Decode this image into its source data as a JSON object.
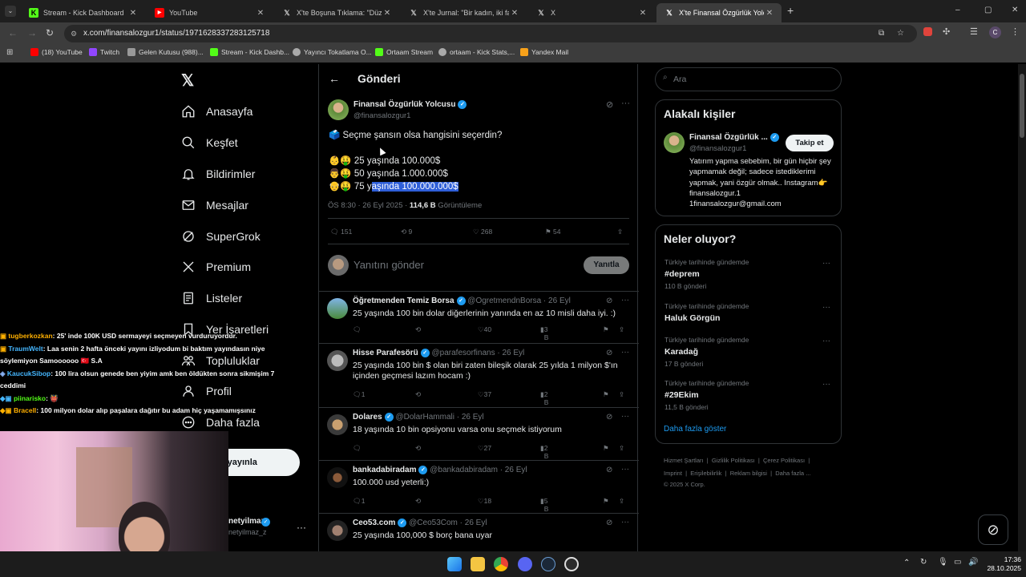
{
  "browser": {
    "tabs": [
      {
        "title": "Stream - Kick Dashboard",
        "icon": "kick-icon"
      },
      {
        "title": "YouTube",
        "icon": "youtube-icon"
      },
      {
        "title": "X'te Boşuna Tıklama: \"Düzce'de",
        "icon": "x-icon"
      },
      {
        "title": "X'te Jurnal: \"Bir kadın, iki farklı",
        "icon": "x-icon"
      },
      {
        "title": "X",
        "icon": "x-icon"
      },
      {
        "title": "X'te Finansal Özgürlük Yolcusu:",
        "icon": "x-icon"
      }
    ],
    "new_tab": "+",
    "url": "x.com/finansalozgur1/status/1971628337283125718",
    "bookmarks": [
      "(18) YouTube",
      "Twitch",
      "Gelen Kutusu (988)...",
      "Stream - Kick Dashb...",
      "Yayıncı Tokatlama O...",
      "Ortaam Stream",
      "ortaam - Kick Stats,...",
      "Yandex Mail"
    ],
    "window_controls": [
      "–",
      "▢",
      "✕"
    ]
  },
  "sidebar": {
    "items": [
      {
        "label": "Anasayfa",
        "icon": "home-icon"
      },
      {
        "label": "Keşfet",
        "icon": "search-icon"
      },
      {
        "label": "Bildirimler",
        "icon": "bell-icon"
      },
      {
        "label": "Mesajlar",
        "icon": "mail-icon"
      },
      {
        "label": "SuperGrok",
        "icon": "grok-icon"
      },
      {
        "label": "Premium",
        "icon": "x-icon"
      },
      {
        "label": "Listeler",
        "icon": "list-icon"
      },
      {
        "label": "Yer İşaretleri",
        "icon": "bookmark-icon"
      },
      {
        "label": "Topluluklar",
        "icon": "people-icon"
      },
      {
        "label": "Profil",
        "icon": "person-icon"
      },
      {
        "label": "Daha fazla",
        "icon": "more-icon"
      }
    ],
    "post_button": "eri yayınla",
    "account_name": "netyilmaz",
    "account_handle": "netyilmaz_z",
    "more": "···"
  },
  "header": {
    "title": "Gönderi",
    "back": "←"
  },
  "tweet": {
    "author": "Finansal Özgürlük Yolcusu",
    "handle": "@finansalozgur1",
    "line1": "Seçme şansın olsa hangisini seçerdin?",
    "line2": "25 yaşında 100.000$",
    "line3": "50 yaşında 1.000.000$",
    "line4_pre": "75 y",
    "line4_sel": "aşında 100.000.000$",
    "time": "ÖS 8:30 · 26 Eyl 2025 · ",
    "views_num": "114,6 B",
    "views_label": " Görüntüleme",
    "stats": {
      "replies": "151",
      "reposts": "9",
      "likes": "268",
      "bookmarks": "54"
    }
  },
  "compose": {
    "placeholder": "Yanıtını gönder",
    "button": "Yanıtla"
  },
  "replies": [
    {
      "name": "Öğretmenden Temiz Borsa",
      "handle": "@OgretmendnBorsa · 26 Eyl",
      "text": "25 yaşında 100 bin dolar diğerlerinin yanında en az 10 misli daha iyi. :)",
      "r": "",
      "rt": "",
      "l": "40",
      "v": "3 B"
    },
    {
      "name": "Hisse Parafesörü",
      "handle": "@parafesorfinans · 26 Eyl",
      "text": "25 yaşında 100 bin $ olan biri zaten bileşik olarak 25 yılda 1 milyon $'ın içinden geçmesi lazım hocam :)",
      "r": "1",
      "rt": "",
      "l": "37",
      "v": "2 B"
    },
    {
      "name": "Dolares",
      "handle": "@DolarHammali · 26 Eyl",
      "text": "18 yaşında 10 bin opsiyonu varsa onu seçmek istiyorum",
      "r": "",
      "rt": "",
      "l": "27",
      "v": "2 B"
    },
    {
      "name": "bankadabiradam",
      "handle": "@bankadabiradam · 26 Eyl",
      "text": "100.000 usd yeterli:)",
      "r": "1",
      "rt": "",
      "l": "18",
      "v": "5 B"
    },
    {
      "name": "Ceo53.com",
      "handle": "@Ceo53Com · 26 Eyl",
      "text": "25 yaşında 100,000 $ borç bana uyar",
      "r": "",
      "rt": "",
      "l": "",
      "v": ""
    }
  ],
  "right": {
    "search_placeholder": "Ara",
    "related_title": "Alakalı kişiler",
    "related_name": "Finansal Özgürlük ...",
    "related_handle": "@finansalozgur1",
    "follow_button": "Takip et",
    "related_bio": "Yatırım yapma sebebim, bir gün hiçbir şey yapmamak değil; sadece istediklerimi yapmak, yani özgür olmak.. Instagram👉 finansalozgur.1 1finansalozgur@gmail.com",
    "trends_title": "Neler oluyor?",
    "trends": [
      {
        "cat": "Türkiye tarihinde gündemde",
        "title": "#deprem",
        "count": "110 B gönderi"
      },
      {
        "cat": "Türkiye tarihinde gündemde",
        "title": "Haluk Görgün",
        "count": ""
      },
      {
        "cat": "Türkiye tarihinde gündemde",
        "title": "Karadağ",
        "count": "17 B gönderi"
      },
      {
        "cat": "Türkiye tarihinde gündemde",
        "title": "#29Ekim",
        "count": "11,5 B gönderi"
      }
    ],
    "show_more": "Daha fazla göster",
    "footer1": [
      "Hizmet Şartları",
      "|",
      "Gizlilik Politikası",
      "|",
      "Çerez Politikası",
      "|"
    ],
    "footer2": [
      "Imprint",
      "|",
      "Erişilebilirlik",
      "|",
      "Reklam bilgisi",
      "|",
      "Daha fazla ..."
    ],
    "copyright": "© 2025 X Corp."
  },
  "chat": [
    {
      "user": "tugberkozkan",
      "msg": ": 25' inde 100K USD sermayeyi seçmeyen vurduruyordur.",
      "color": "#ffb000"
    },
    {
      "user": "TraumWelt",
      "msg": ": Laa senin 2 hafta önceki yayını izliyodum bi baktım yayındasın niye söylemiyon Samoooooo 🇹🇷 S.A",
      "color": "#45b6fe"
    },
    {
      "user": "KaucukSibop",
      "msg": ": 100 lira olsun genede ben yiyim amk ben öldükten sonra sikmişim 7 ceddimi",
      "color": "#45b6fe"
    },
    {
      "user": "piinarisko",
      "msg": ": 👹",
      "color": "#53fc18"
    },
    {
      "user": "Bracell",
      "msg": ": 100 milyon dolar alıp paşalara dağıtır bu adam hiç yaşamamışsınız",
      "color": "#ffb000"
    }
  ],
  "taskbar": {
    "time": "17:36",
    "date": "28.10.2025"
  }
}
